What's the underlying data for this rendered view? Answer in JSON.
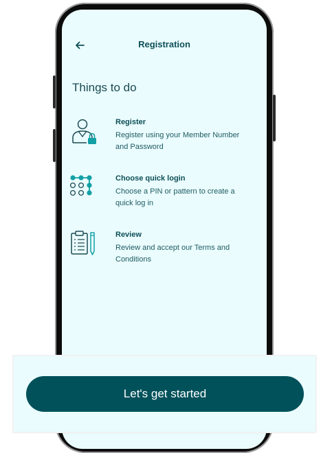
{
  "header": {
    "title": "Registration",
    "back_icon": "arrow-left-icon"
  },
  "heading": "Things to do",
  "tasks": [
    {
      "icon": "user-lock-icon",
      "title": "Register",
      "description": "Register using your Member Number and Password"
    },
    {
      "icon": "pin-pattern-icon",
      "title": "Choose quick login",
      "description": "Choose a PIN or pattern to create a quick log in"
    },
    {
      "icon": "clipboard-pen-icon",
      "title": "Review",
      "description": "Review and accept our Terms and Conditions"
    }
  ],
  "cta": {
    "label": "Let's get started"
  },
  "colors": {
    "accent": "#00515a",
    "screen_bg": "#eafcfd",
    "icon_teal": "#12a0a6"
  }
}
